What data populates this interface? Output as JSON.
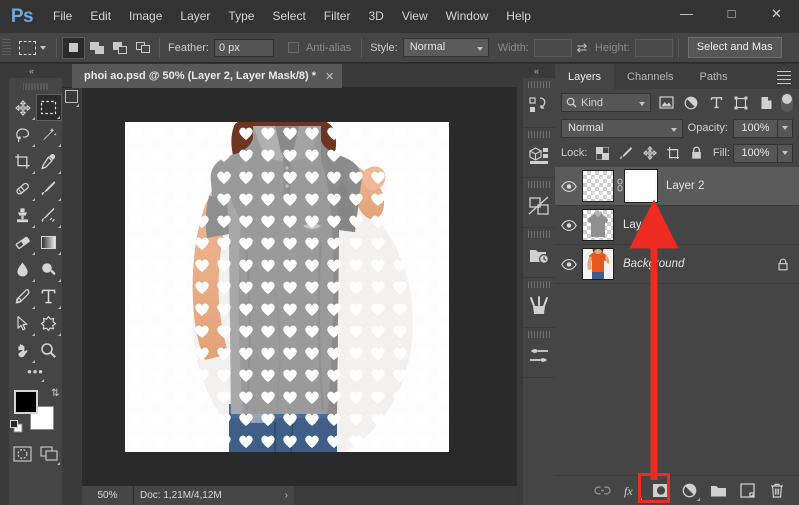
{
  "app": {
    "logo": "Ps"
  },
  "menubar": {
    "items": [
      "File",
      "Edit",
      "Image",
      "Layer",
      "Type",
      "Select",
      "Filter",
      "3D",
      "View",
      "Window",
      "Help"
    ],
    "window_controls": [
      {
        "name": "minimize",
        "glyph": "—"
      },
      {
        "name": "maximize",
        "glyph": "□"
      },
      {
        "name": "close",
        "glyph": "✕"
      }
    ]
  },
  "options_bar": {
    "tool": "rectangular-marquee",
    "selection_modes": [
      "new-selection",
      "add-to-selection",
      "subtract-from-selection",
      "intersect-with-selection"
    ],
    "active_selection_mode": "new-selection",
    "feather_label": "Feather:",
    "feather_value": "0 px",
    "antialias_label": "Anti-alias",
    "antialias_checked": false,
    "style_label": "Style:",
    "style_value": "Normal",
    "width_label": "Width:",
    "width_value": "",
    "height_label": "Height:",
    "height_value": "",
    "swap_icon": "swap-arrows",
    "select_and_mask_label": "Select and Mas"
  },
  "toolbar": {
    "collapse_glyph": "«",
    "tools": [
      {
        "name": "move-tool",
        "has_flyout": true
      },
      {
        "name": "rectangular-marquee-tool",
        "has_flyout": true,
        "selected": true
      },
      {
        "name": "lasso-tool",
        "has_flyout": true
      },
      {
        "name": "quick-selection-tool",
        "has_flyout": true
      },
      {
        "name": "crop-tool",
        "has_flyout": true
      },
      {
        "name": "eyedropper-tool",
        "has_flyout": true
      },
      {
        "name": "healing-brush-tool",
        "has_flyout": true
      },
      {
        "name": "brush-tool",
        "has_flyout": true
      },
      {
        "name": "clone-stamp-tool",
        "has_flyout": true
      },
      {
        "name": "history-brush-tool",
        "has_flyout": true
      },
      {
        "name": "eraser-tool",
        "has_flyout": true
      },
      {
        "name": "gradient-tool",
        "has_flyout": true
      },
      {
        "name": "blur-tool",
        "has_flyout": true
      },
      {
        "name": "dodge-tool",
        "has_flyout": true
      },
      {
        "name": "pen-tool",
        "has_flyout": true
      },
      {
        "name": "type-tool",
        "has_flyout": true
      },
      {
        "name": "path-selection-tool",
        "has_flyout": true
      },
      {
        "name": "custom-shape-tool",
        "has_flyout": true
      },
      {
        "name": "hand-tool",
        "has_flyout": true
      },
      {
        "name": "zoom-tool",
        "has_flyout": false
      }
    ],
    "more_tools_glyph": "•••",
    "foreground_color": "#000000",
    "background_color": "#ffffff",
    "quickmask_name": "quick-mask-mode",
    "screenmode_name": "screen-mode"
  },
  "document": {
    "tab_title": "phoi ao.psd @ 50% (Layer 2, Layer Mask/8) *",
    "tab_close_glyph": "✕",
    "zoom_level": "50%",
    "doc_size": "Doc: 1,21M/4,12M",
    "doc_arrow_glyph": "›"
  },
  "mini_dock": {
    "collapse_glyph": "«",
    "panels": [
      {
        "name": "history-panel-icon"
      },
      {
        "name": "3d-panel-icon"
      },
      {
        "name": "adjustments-panel-icon"
      },
      {
        "name": "history-log-panel-icon"
      },
      {
        "name": "brushes-panel-icon"
      },
      {
        "name": "brush-settings-panel-icon"
      }
    ]
  },
  "layers_panel": {
    "tabs": [
      {
        "label": "Layers",
        "active": true
      },
      {
        "label": "Channels",
        "active": false
      },
      {
        "label": "Paths",
        "active": false
      }
    ],
    "menu_icon": "panel-menu-icon",
    "filter": {
      "kind_label": "Kind",
      "search_icon": "search-icon",
      "type_filters": [
        "pixel-layers-filter",
        "adjustment-layers-filter",
        "type-layers-filter",
        "shape-layers-filter",
        "smart-object-filter"
      ],
      "toggle_name": "filter-enable-toggle"
    },
    "blend_mode": "Normal",
    "opacity_label": "Opacity:",
    "opacity_value": "100%",
    "lock_label": "Lock:",
    "lock_icons": [
      "lock-transparent-pixels",
      "lock-image-pixels",
      "lock-position",
      "lock-artboard-nesting",
      "lock-all"
    ],
    "fill_label": "Fill:",
    "fill_value": "100%",
    "layers": [
      {
        "name": "Layer 2",
        "visible": true,
        "selected": true,
        "italic": false,
        "locked": false,
        "has_mask": true,
        "thumb_type": "transparent",
        "link_icon": "mask-link-icon"
      },
      {
        "name": "Layer 1",
        "visible": true,
        "selected": false,
        "italic": false,
        "locked": false,
        "has_mask": false,
        "thumb_type": "gray-shirt"
      },
      {
        "name": "Background",
        "visible": true,
        "selected": false,
        "italic": true,
        "locked": true,
        "has_mask": false,
        "thumb_type": "photo"
      }
    ],
    "bottom_buttons": [
      {
        "name": "link-layers-button",
        "icon": "link-icon"
      },
      {
        "name": "layer-style-button",
        "icon": "fx-icon"
      },
      {
        "name": "add-layer-mask-button",
        "icon": "layer-mask-icon",
        "highlighted": true
      },
      {
        "name": "new-fill-adjustment-button",
        "icon": "half-circle-icon"
      },
      {
        "name": "new-group-button",
        "icon": "folder-icon"
      },
      {
        "name": "new-layer-button",
        "icon": "new-layer-icon"
      },
      {
        "name": "delete-layer-button",
        "icon": "trash-icon"
      }
    ]
  },
  "annotation": {
    "color": "#ee2b22",
    "arrow_name": "red-arrow-pointing-to-layer-mask-thumbnail",
    "highlight_box_name": "red-highlight-on-add-layer-mask-button"
  }
}
